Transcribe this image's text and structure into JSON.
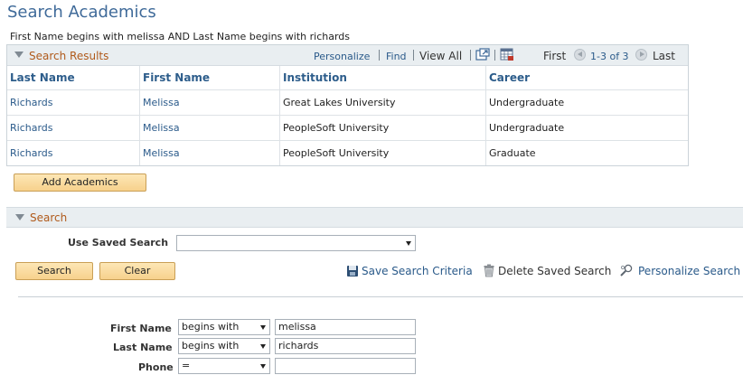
{
  "page": {
    "title": "Search Academics",
    "criteria": "First Name begins with melissa AND Last Name begins with richards"
  },
  "results": {
    "title": "Search Results",
    "nav": {
      "personalize": "Personalize",
      "find": "Find",
      "view_all": "View All",
      "first": "First",
      "range": "1-3 of 3",
      "last": "Last"
    },
    "columns": [
      "Last Name",
      "First Name",
      "Institution",
      "Career"
    ],
    "rows": [
      [
        "Richards",
        "Melissa",
        "Great Lakes University",
        "Undergraduate"
      ],
      [
        "Richards",
        "Melissa",
        "PeopleSoft University",
        "Undergraduate"
      ],
      [
        "Richards",
        "Melissa",
        "PeopleSoft University",
        "Graduate"
      ]
    ]
  },
  "add_button": "Add Academics",
  "search": {
    "title": "Search",
    "saved_search_label": "Use Saved Search",
    "saved_search_value": "",
    "search_button": "Search",
    "clear_button": "Clear",
    "save_criteria": "Save Search Criteria",
    "delete_saved": "Delete Saved Search",
    "personalize_search": "Personalize Search",
    "fields": [
      {
        "label": "First Name",
        "operator": "begins with",
        "value": "melissa"
      },
      {
        "label": "Last Name",
        "operator": "begins with",
        "value": "richards"
      },
      {
        "label": "Phone",
        "operator": "=",
        "value": ""
      }
    ]
  },
  "icons": {
    "collapse": "triangle-down-icon",
    "zoom": "new-window-icon",
    "download": "spreadsheet-download-icon",
    "prev": "arrow-left-icon",
    "next": "arrow-right-icon",
    "save": "floppy-disk-icon",
    "delete": "trash-icon",
    "personalize": "magnifier-gear-icon"
  },
  "colors": {
    "title": "#3f6a99",
    "section_title": "#b05a1b",
    "link": "#2a5a8a",
    "header_bg": "#e9eef1",
    "button_bg": "#f7d18c"
  }
}
